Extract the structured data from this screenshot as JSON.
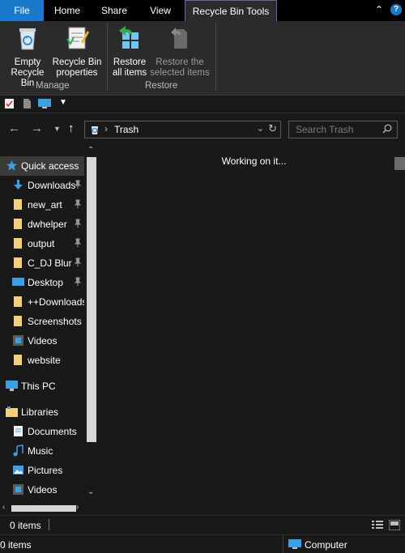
{
  "ribbon_tabs": {
    "file": "File",
    "home": "Home",
    "share": "Share",
    "view": "View",
    "recycle_bin_tools": "Recycle Bin Tools"
  },
  "ribbon": {
    "empty_recycle_bin": "Empty\nRecycle Bin",
    "recycle_bin_properties": "Recycle Bin\nproperties",
    "restore_all": "Restore\nall items",
    "restore_selected": "Restore the\nselected items",
    "group_manage": "Manage",
    "group_restore": "Restore"
  },
  "address": {
    "path": "Trash",
    "search_placeholder": "Search Trash"
  },
  "nav_pane": {
    "quick_access": "Quick access",
    "items": [
      {
        "label": "Downloads",
        "icon": "download-arrow-icon",
        "pinned": true
      },
      {
        "label": "new_art",
        "icon": "folder-icon",
        "pinned": true
      },
      {
        "label": "dwhelper",
        "icon": "folder-icon",
        "pinned": true
      },
      {
        "label": "output",
        "icon": "folder-icon",
        "pinned": true
      },
      {
        "label": "C_DJ Blur",
        "icon": "folder-icon",
        "pinned": true
      },
      {
        "label": "Desktop",
        "icon": "desktop-icon",
        "pinned": true
      },
      {
        "label": "++Downloads",
        "icon": "folder-icon",
        "pinned": false
      },
      {
        "label": "Screenshots",
        "icon": "folder-icon",
        "pinned": false
      },
      {
        "label": "Videos",
        "icon": "videos-icon",
        "pinned": false
      },
      {
        "label": "website",
        "icon": "folder-icon",
        "pinned": false
      }
    ],
    "this_pc": "This PC",
    "libraries": "Libraries",
    "library_items": [
      {
        "label": "Documents",
        "icon": "documents-icon"
      },
      {
        "label": "Music",
        "icon": "music-icon"
      },
      {
        "label": "Pictures",
        "icon": "pictures-icon"
      },
      {
        "label": "Videos",
        "icon": "videos-icon"
      }
    ]
  },
  "content": {
    "status_message": "Working on it..."
  },
  "status_bar": {
    "item_count": "0 items",
    "item_count_bottom": "0 items",
    "location": "Computer"
  }
}
